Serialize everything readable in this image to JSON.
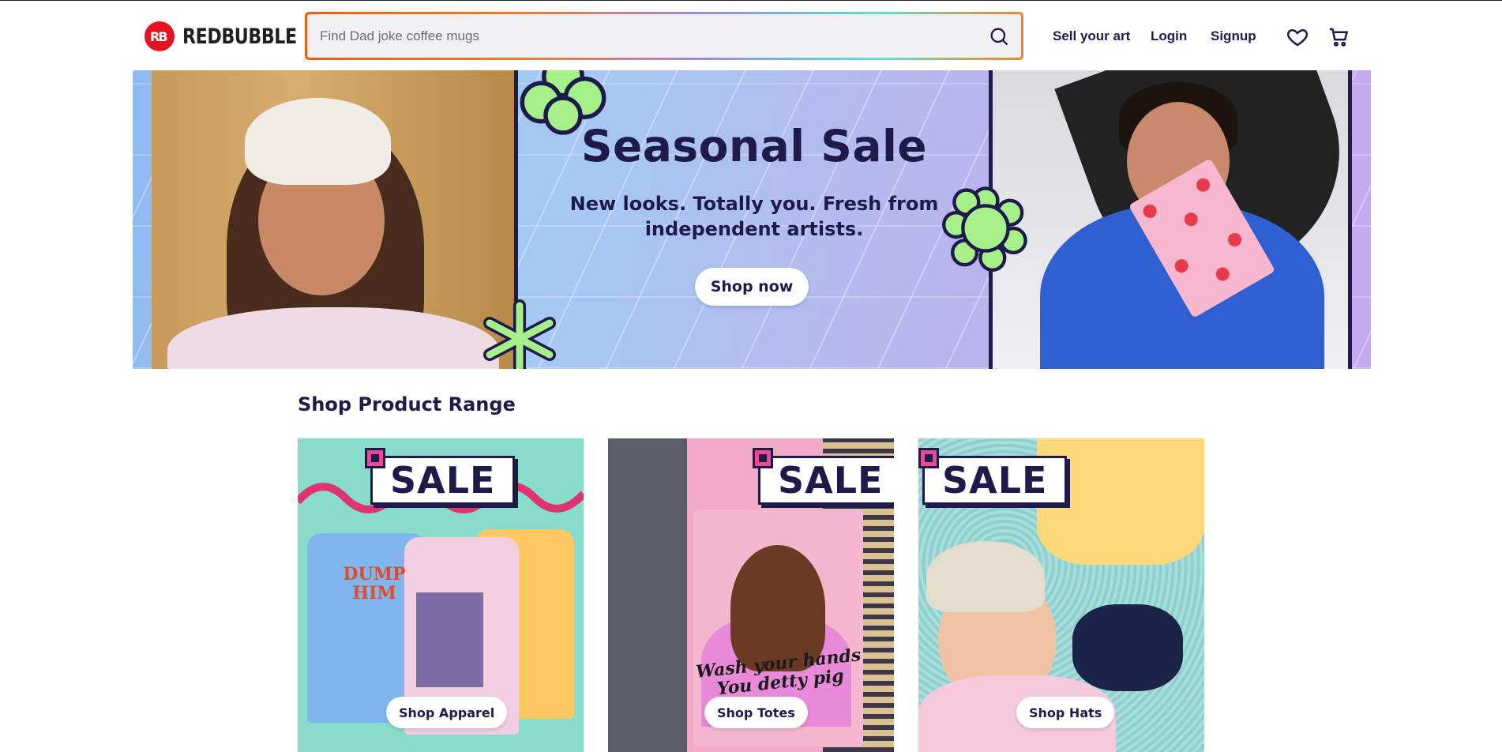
{
  "brand": {
    "name": "REDBUBBLE",
    "mark": "RB",
    "color": "#e41321"
  },
  "search": {
    "placeholder": "Find Dad joke coffee mugs"
  },
  "nav": {
    "sell": "Sell your art",
    "login": "Login",
    "signup": "Signup"
  },
  "icons": {
    "search": "search-icon",
    "wishlist": "heart-icon",
    "cart": "cart-icon"
  },
  "hero": {
    "title": "Seasonal Sale",
    "subtitle": "New looks. Totally you. Fresh from independent artists.",
    "cta": "Shop now"
  },
  "section": {
    "title": "Shop Product Range"
  },
  "cards": [
    {
      "badge": "SALE",
      "button": "Shop Apparel",
      "shirt_text": "DUMP HIM"
    },
    {
      "badge": "SALE",
      "button": "Shop Totes",
      "tote_text": "Wash your hands You detty pig"
    },
    {
      "badge": "SALE",
      "button": "Shop Hats"
    }
  ],
  "colors": {
    "ink": "#1e1b4b",
    "accent_pink": "#ec4a93",
    "flower_green": "#a6f08a"
  }
}
